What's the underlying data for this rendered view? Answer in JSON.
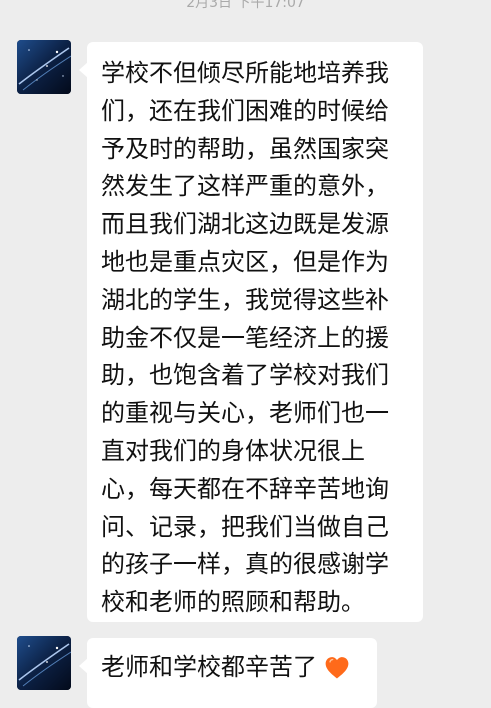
{
  "timestamp": "2月3日 下午17:07",
  "messages": [
    {
      "text": "学校不但倾尽所能地培养我们，还在我们困难的时候给予及时的帮助，虽然国家突然发生了这样严重的意外，而且我们湖北这边既是发源地也是重点灾区，但是作为湖北的学生，我觉得这些补助金不仅是一笔经济上的援助，也饱含着了学校对我们的重视与关心，老师们也一直对我们的身体状况很上心，每天都在不辞辛苦地询问、记录，把我们当做自己的孩子一样，真的很感谢学校和老师的照顾和帮助。"
    },
    {
      "text": "老师和学校都辛苦了",
      "emoji": "orange-heart"
    }
  ],
  "colors": {
    "background": "#ededed",
    "bubble": "#ffffff",
    "heart": "#ff6a1a"
  }
}
